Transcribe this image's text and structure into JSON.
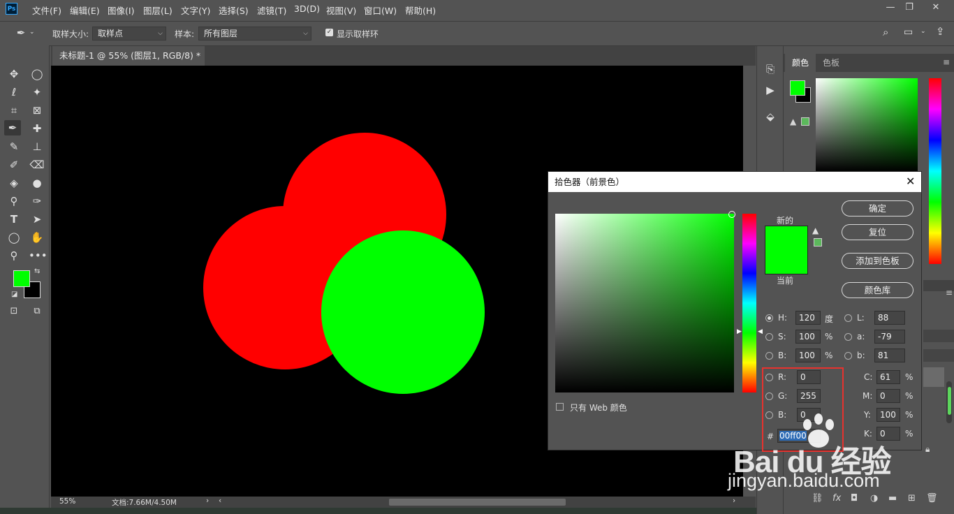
{
  "menubar": {
    "logo": "Ps",
    "items": [
      "文件(F)",
      "编辑(E)",
      "图像(I)",
      "图层(L)",
      "文字(Y)",
      "选择(S)",
      "滤镜(T)",
      "3D(D)",
      "视图(V)",
      "窗口(W)",
      "帮助(H)"
    ]
  },
  "options": {
    "sample_size_label": "取样大小:",
    "sample_size_value": "取样点",
    "sample_label": "样本:",
    "sample_value": "所有图层",
    "show_ring_label": "显示取样环"
  },
  "document": {
    "tab_title": "未标题-1 @ 55% (图层1, RGB/8) *",
    "close_glyph": "×",
    "zoom": "55%",
    "doc_info": "文档:7.66M/4.50M"
  },
  "panel": {
    "tab_color": "颜色",
    "tab_swatches": "色板"
  },
  "dialog": {
    "title": "拾色器（前景色）",
    "new_label": "新的",
    "current_label": "当前",
    "ok": "确定",
    "reset": "复位",
    "add_to_swatches": "添加到色板",
    "color_libraries": "颜色库",
    "web_only": "只有 Web 颜色",
    "fields": {
      "H": {
        "label": "H:",
        "value": "120",
        "unit": "度"
      },
      "S": {
        "label": "S:",
        "value": "100",
        "unit": "%"
      },
      "B": {
        "label": "B:",
        "value": "100",
        "unit": "%"
      },
      "R": {
        "label": "R:",
        "value": "0"
      },
      "G": {
        "label": "G:",
        "value": "255"
      },
      "Bb": {
        "label": "B:",
        "value": "0"
      },
      "L": {
        "label": "L:",
        "value": "88"
      },
      "a": {
        "label": "a:",
        "value": "-79"
      },
      "b": {
        "label": "b:",
        "value": "81"
      },
      "C": {
        "label": "C:",
        "value": "61",
        "unit": "%"
      },
      "M": {
        "label": "M:",
        "value": "0",
        "unit": "%"
      },
      "Y": {
        "label": "Y:",
        "value": "100",
        "unit": "%"
      },
      "K": {
        "label": "K:",
        "value": "0",
        "unit": "%"
      },
      "hex": {
        "label": "#",
        "value": "00ff00"
      }
    }
  },
  "watermark": {
    "logo": "Bai du 经验",
    "url": "jingyan.baidu.com"
  },
  "colors": {
    "foreground": "#00ff00",
    "background": "#000000",
    "red_circle": "#ff0000",
    "green_circle": "#00ff00",
    "highlight": "#e8322e"
  }
}
